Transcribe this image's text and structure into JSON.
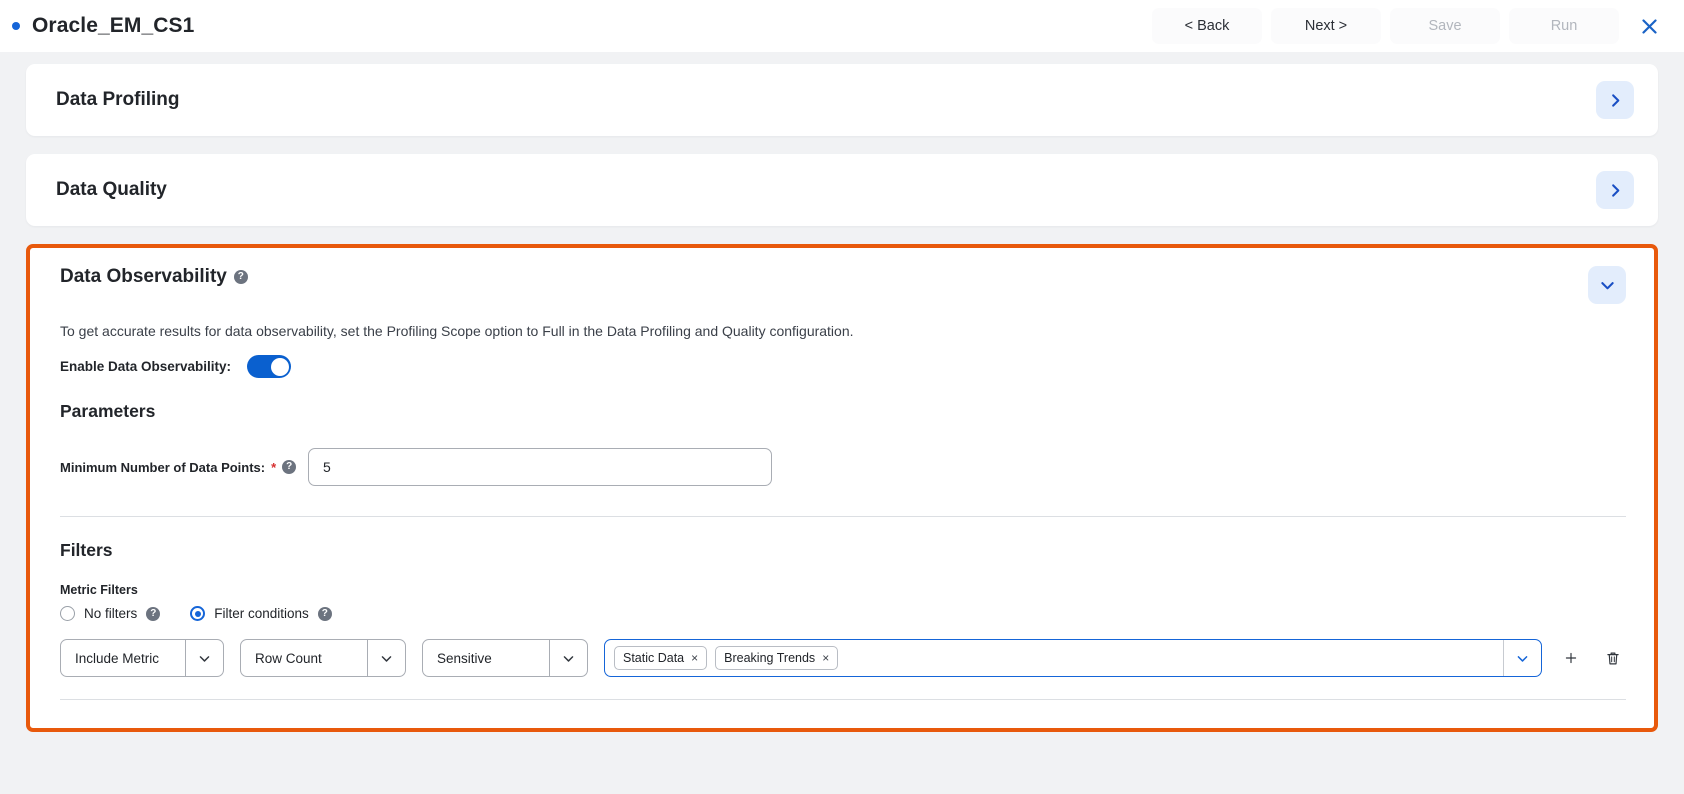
{
  "header": {
    "status_dot_color": "#1565d8",
    "title": "Oracle_EM_CS1",
    "buttons": [
      {
        "label": "< Back",
        "disabled": false,
        "name": "back-button"
      },
      {
        "label": "Next >",
        "disabled": false,
        "name": "next-button"
      },
      {
        "label": "Save",
        "disabled": true,
        "name": "save-button"
      },
      {
        "label": "Run",
        "disabled": true,
        "name": "run-button"
      }
    ],
    "close_icon": "close-icon"
  },
  "collapsed_sections": [
    {
      "title": "Data Profiling",
      "chevron": "chevron-right-icon"
    },
    {
      "title": "Data Quality",
      "chevron": "chevron-right-icon"
    }
  ],
  "observability": {
    "title": "Data Observability",
    "title_help_icon": "help-icon",
    "chevron": "chevron-down-icon",
    "highlight_color": "#e8590c",
    "description": "To get accurate results for data observability, set the Profiling Scope option to Full in the Data Profiling and Quality configuration.",
    "enable_label": "Enable Data Observability:",
    "enable_value": true,
    "parameters": {
      "heading": "Parameters",
      "min_points_label": "Minimum Number of Data Points:",
      "min_points_required": "*",
      "min_points_help_icon": "help-icon",
      "min_points_value": "5"
    },
    "filters": {
      "heading": "Filters",
      "metric_filters_label": "Metric Filters",
      "radios": [
        {
          "label": "No filters",
          "selected": false,
          "help_icon": "help-icon"
        },
        {
          "label": "Filter conditions",
          "selected": true,
          "help_icon": "help-icon"
        }
      ],
      "condition_row": {
        "include_metric": "Include Metric",
        "metric": "Row Count",
        "sensitivity": "Sensitive",
        "chips": [
          {
            "label": "Static Data",
            "remove": "×"
          },
          {
            "label": "Breaking Trends",
            "remove": "×"
          }
        ],
        "add_icon": "plus-icon",
        "delete_icon": "trash-icon"
      }
    }
  }
}
